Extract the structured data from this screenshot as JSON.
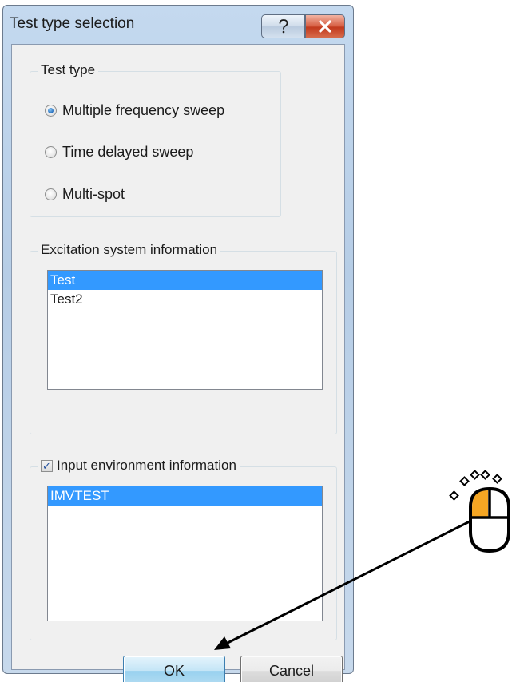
{
  "dialog": {
    "title": "Test type selection",
    "help_icon": "question-mark-icon",
    "close_icon": "close-x-icon"
  },
  "test_type": {
    "legend": "Test type",
    "options": [
      {
        "label": "Multiple frequency sweep",
        "checked": true
      },
      {
        "label": "Time delayed sweep",
        "checked": false
      },
      {
        "label": "Multi-spot",
        "checked": false
      }
    ]
  },
  "excitation": {
    "legend": "Excitation system information",
    "items": [
      {
        "label": "Test",
        "selected": true
      },
      {
        "label": "Test2",
        "selected": false
      }
    ]
  },
  "input_env": {
    "legend": "Input environment information",
    "checked": true,
    "checkmark": "✓",
    "items": [
      {
        "label": "IMVTEST",
        "selected": true
      }
    ]
  },
  "buttons": {
    "ok": "OK",
    "cancel": "Cancel"
  },
  "annotation": {
    "icon": "mouse-left-click-icon",
    "arrow": "pointer-arrow-to-ok",
    "colors": {
      "highlight": "#f5a623",
      "stroke": "#000000"
    }
  }
}
